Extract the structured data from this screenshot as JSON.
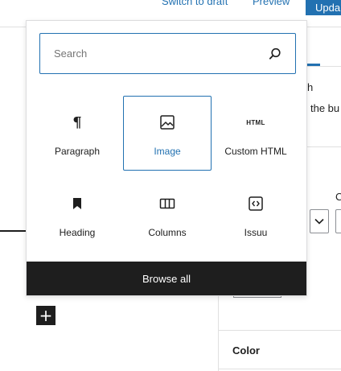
{
  "topbar": {
    "switch_draft": "Switch to draft",
    "preview": "Preview",
    "update": "Upda"
  },
  "sidebar": {
    "fragment_1": "h",
    "fragment_2": "the bu",
    "fragment_3": "C",
    "color_label": "Color"
  },
  "inserter": {
    "search_placeholder": "Search",
    "blocks": [
      {
        "label": "Paragraph",
        "icon": "paragraph-icon"
      },
      {
        "label": "Image",
        "icon": "image-icon",
        "selected": true
      },
      {
        "label": "Custom HTML",
        "icon": "html-icon",
        "glyph": "HTML"
      },
      {
        "label": "Heading",
        "icon": "bookmark-icon"
      },
      {
        "label": "Columns",
        "icon": "columns-icon"
      },
      {
        "label": "Issuu",
        "icon": "embed-icon"
      }
    ],
    "browse_all": "Browse all"
  },
  "editor": {
    "add_block_symbol": "+"
  },
  "colors": {
    "accent": "#2271b1",
    "dark": "#1e1e1e",
    "border": "#e0e0e0"
  }
}
